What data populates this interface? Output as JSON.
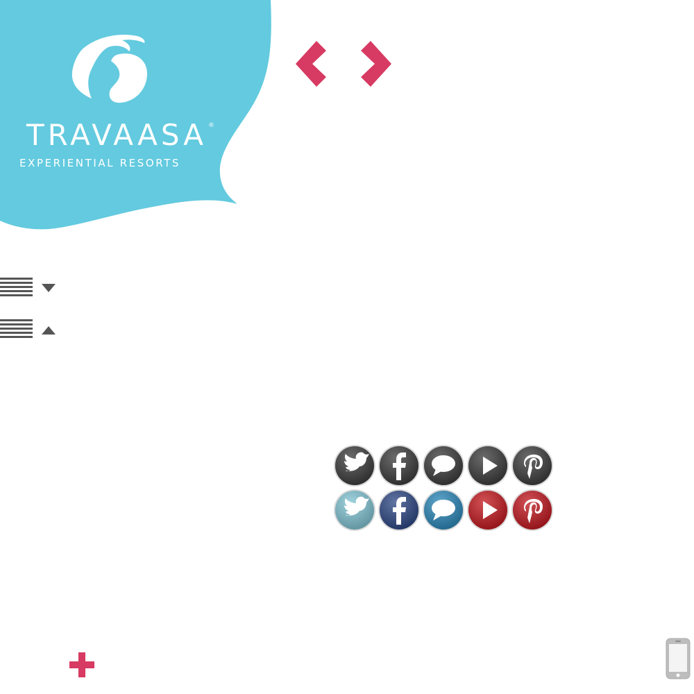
{
  "logo": {
    "wordmark": "TRAVAASA",
    "registered_mark": "®",
    "tagline": "EXPERIENTIAL RESORTS",
    "blob_color": "#63CADF"
  },
  "nav": {
    "prev_icon": "chevron-left-icon",
    "next_icon": "chevron-right-icon",
    "accent_color": "#D73A62"
  },
  "menu_toggles": [
    {
      "icon": "hamburger-menu-icon",
      "indicator": "caret-down-icon"
    },
    {
      "icon": "hamburger-menu-icon",
      "indicator": "caret-up-icon"
    }
  ],
  "social": {
    "default_row": [
      {
        "name": "twitter",
        "icon": "twitter-bird-icon",
        "color": "#3a3a3a"
      },
      {
        "name": "facebook",
        "icon": "facebook-f-icon",
        "color": "#3a3a3a"
      },
      {
        "name": "chat",
        "icon": "speech-bubble-icon",
        "color": "#3a3a3a"
      },
      {
        "name": "youtube",
        "icon": "play-icon",
        "color": "#3a3a3a"
      },
      {
        "name": "pinterest",
        "icon": "pinterest-p-icon",
        "color": "#3a3a3a"
      }
    ],
    "hover_row": [
      {
        "name": "twitter",
        "icon": "twitter-bird-icon",
        "color": "#7fc3d2"
      },
      {
        "name": "facebook",
        "icon": "facebook-f-icon",
        "color": "#2c4684"
      },
      {
        "name": "chat",
        "icon": "speech-bubble-icon",
        "color": "#2a86b8"
      },
      {
        "name": "youtube",
        "icon": "play-icon",
        "color": "#c2171d"
      },
      {
        "name": "pinterest",
        "icon": "pinterest-p-icon",
        "color": "#c0161e"
      }
    ]
  },
  "plus_icon": "plus-icon",
  "mobile_icon": "mobile-phone-icon"
}
